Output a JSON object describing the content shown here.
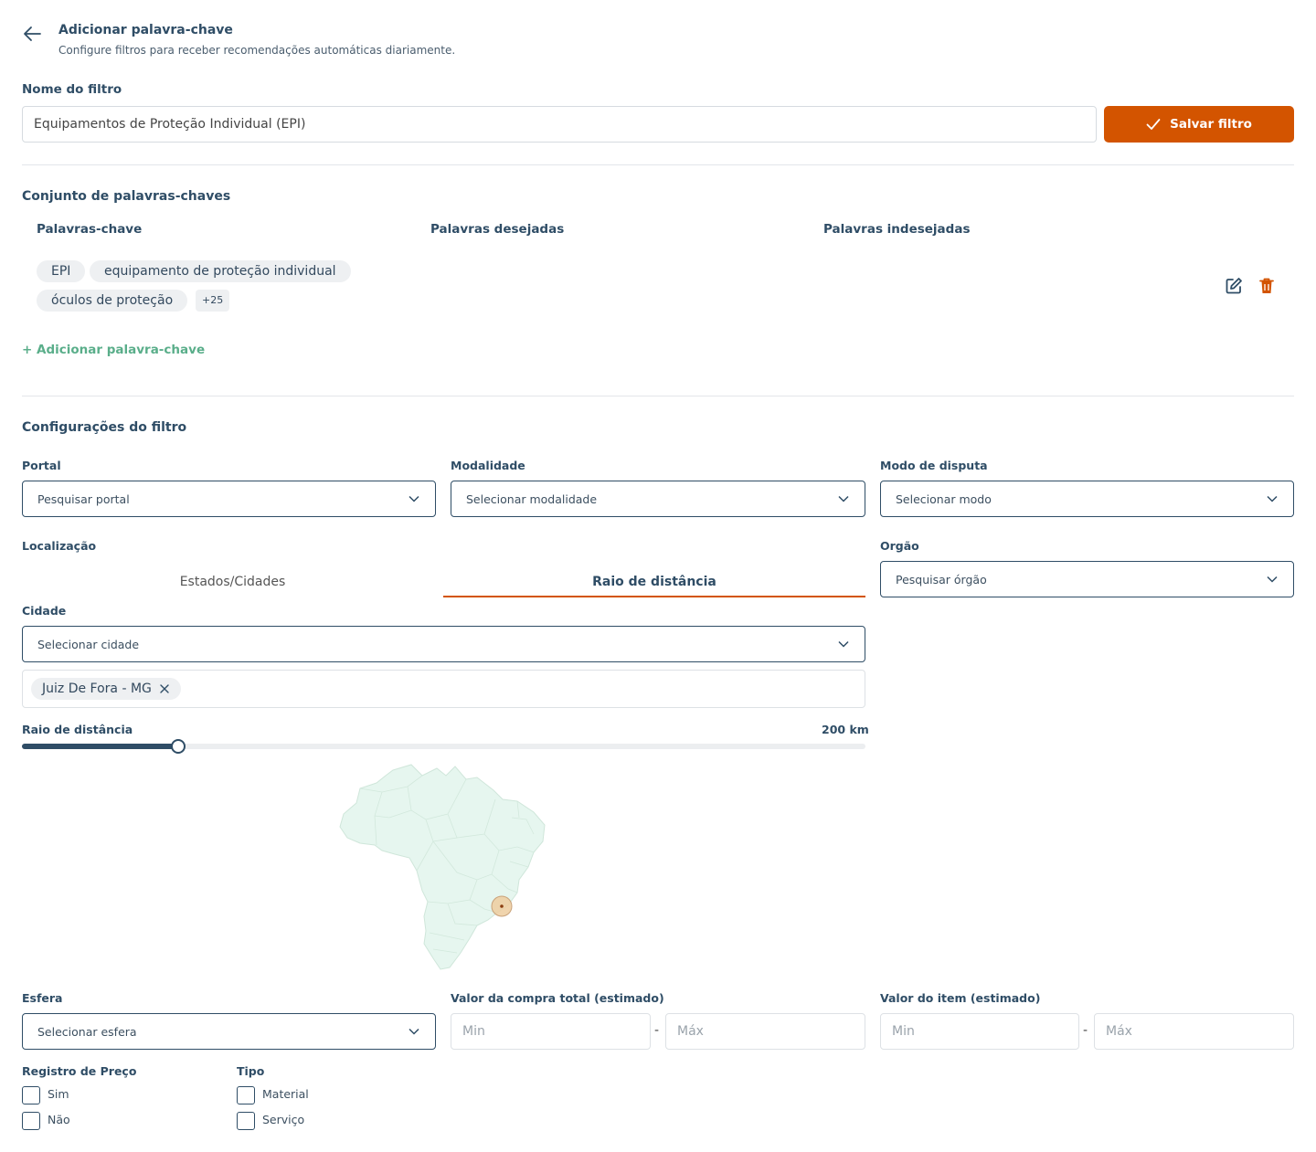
{
  "header": {
    "title": "Adicionar palavra-chave",
    "subtitle": "Configure filtros para receber recomendações automáticas diariamente."
  },
  "filter_name": {
    "label": "Nome do filtro",
    "value": "Equipamentos de Proteção Individual (EPI)",
    "save_label": "Salvar filtro"
  },
  "keywords": {
    "title": "Conjunto de palavras-chaves",
    "columns": [
      "Palavras-chave",
      "Palavras desejadas",
      "Palavras indesejadas"
    ],
    "chips": [
      "EPI",
      "equipamento de proteção individual",
      "óculos de proteção"
    ],
    "more": "+25",
    "add_label": "+ Adicionar palavra-chave"
  },
  "config": {
    "title": "Configurações do filtro",
    "portal": {
      "label": "Portal",
      "placeholder": "Pesquisar portal"
    },
    "modalidade": {
      "label": "Modalidade",
      "placeholder": "Selecionar modalidade"
    },
    "modo": {
      "label": "Modo de disputa",
      "placeholder": "Selecionar modo"
    },
    "localizacao": {
      "label": "Localização",
      "tabs": [
        "Estados/Cidades",
        "Raio de distância"
      ],
      "active_tab": 1,
      "cidade_label": "Cidade",
      "cidade_placeholder": "Selecionar cidade",
      "selected_city": "Juiz De Fora - MG",
      "raio_label": "Raio de distância",
      "raio_value": "200 km",
      "raio_fraction": 0.185
    },
    "orgao": {
      "label": "Orgão",
      "placeholder": "Pesquisar órgão"
    },
    "esfera": {
      "label": "Esfera",
      "placeholder": "Selecionar esfera"
    },
    "valor_compra": {
      "label": "Valor da compra total (estimado)",
      "min": "Min",
      "max": "Máx"
    },
    "valor_item": {
      "label": "Valor do item (estimado)",
      "min": "Min",
      "max": "Máx"
    },
    "registro": {
      "label": "Registro de Preço",
      "options": [
        "Sim",
        "Não"
      ]
    },
    "tipo": {
      "label": "Tipo",
      "options": [
        "Material",
        "Serviço"
      ]
    }
  },
  "colors": {
    "accent": "#d35400",
    "primary": "#2f4d66",
    "green": "#5aae8a",
    "map_fill": "#e6f6ef"
  }
}
